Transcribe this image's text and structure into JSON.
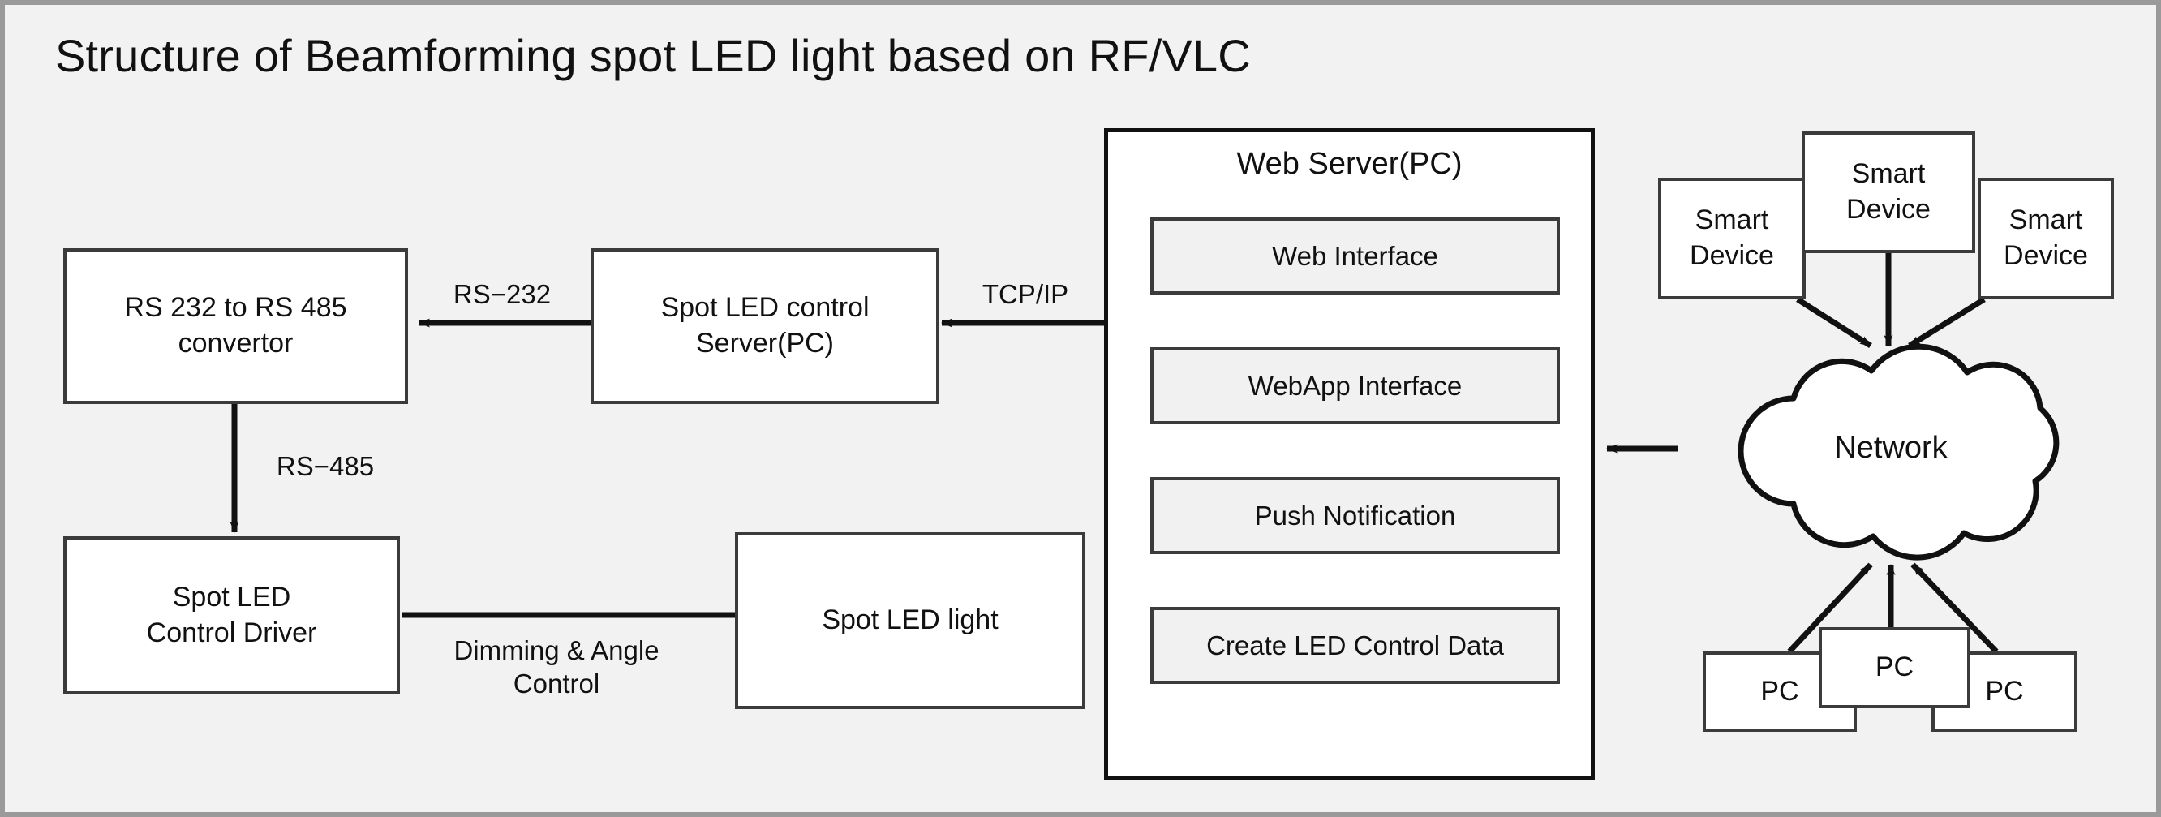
{
  "diagram": {
    "title": "Structure of Beamforming spot LED light based on RF/VLC",
    "background_color": "#f2f2f2",
    "frame_border_color": "#9a9a9a",
    "box_border_color": "#3b3b3b",
    "panel_border_color": "#111111",
    "subbox_fill_color": "#f1f1f1"
  },
  "nodes": {
    "converter": "RS 232 to RS 485\nconvertor",
    "control_server": "Spot LED control\nServer(PC)",
    "control_driver": "Spot LED\nControl Driver",
    "led_light": "Spot LED light",
    "network": "Network"
  },
  "web_server": {
    "title": "Web Server(PC)",
    "items": [
      {
        "label": "Web Interface"
      },
      {
        "label": "WebApp Interface"
      },
      {
        "label": "Push Notification"
      },
      {
        "label": "Create LED Control Data"
      }
    ]
  },
  "smart_devices": [
    {
      "label": "Smart\nDevice"
    },
    {
      "label": "Smart\nDevice"
    },
    {
      "label": "Smart\nDevice"
    }
  ],
  "pcs": [
    {
      "label": "PC"
    },
    {
      "label": "PC"
    },
    {
      "label": "PC"
    }
  ],
  "edge_labels": {
    "rs232": "RS−232",
    "rs485": "RS−485",
    "tcpip": "TCP/IP",
    "dimming": "Dimming & Angle\nControl"
  }
}
